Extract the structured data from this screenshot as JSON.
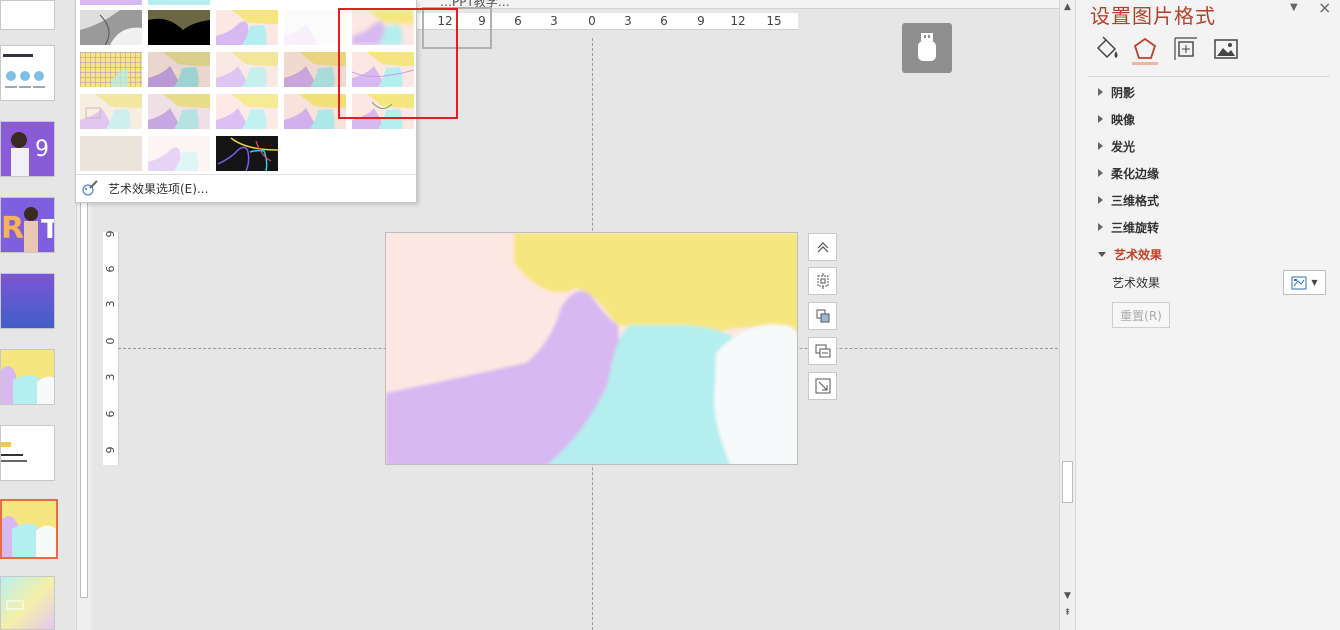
{
  "tab_title": "…PPT教学…",
  "ruler": {
    "horizontal_ticks": [
      "12",
      "9",
      "6",
      "3",
      "0",
      "3",
      "6",
      "9",
      "12",
      "15"
    ],
    "vertical_ticks": [
      "9",
      "6",
      "3",
      "0",
      "3",
      "6",
      "9"
    ]
  },
  "pane": {
    "title": "设置图片格式",
    "sections": [
      "阴影",
      "映像",
      "发光",
      "柔化边缘",
      "三维格式",
      "三维旋转",
      "艺术效果"
    ],
    "art_effect_label": "艺术效果",
    "reset_label": "重置(R)"
  },
  "gallery": {
    "option_label": "艺术效果选项(E)..."
  },
  "colors": {
    "accent": "#b0432b",
    "selection_border": "#e36c4a",
    "highlight_frame": "#e02020",
    "slide_yellow": "#f6e67f",
    "slide_purple": "#d8b8f1",
    "slide_cyan": "#b4eeee",
    "slide_pink": "#fde7e2"
  }
}
